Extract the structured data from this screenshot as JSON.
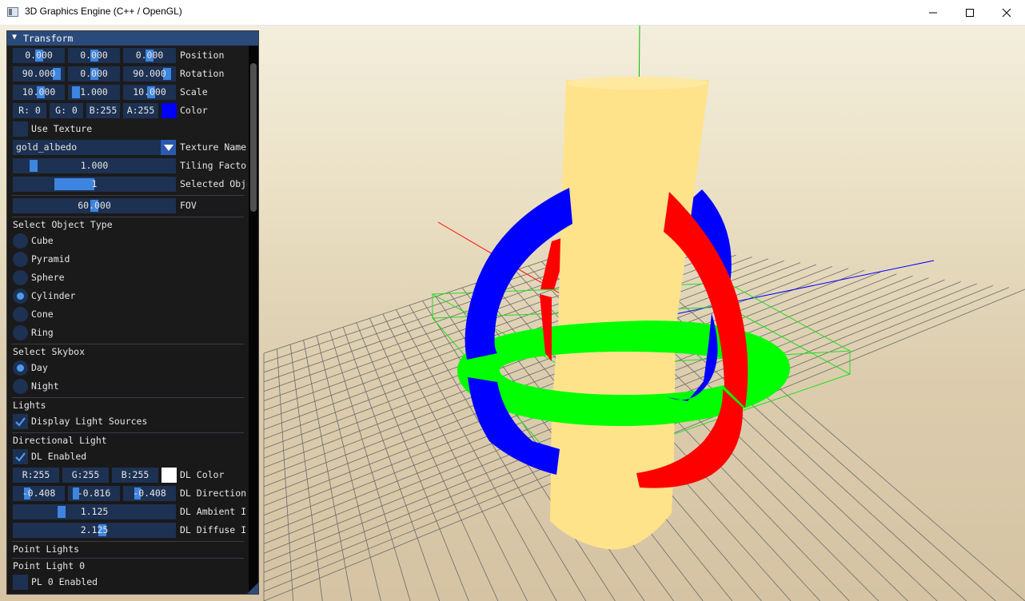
{
  "window": {
    "title": "3D Graphics Engine (C++ / OpenGL)"
  },
  "panel": {
    "header": "Transform",
    "position": {
      "x": "0.000",
      "y": "0.000",
      "z": "0.000",
      "label": "Position"
    },
    "rotation": {
      "x": "90.000",
      "y": "0.000",
      "z": "90.000",
      "label": "Rotation"
    },
    "scale": {
      "x": "10.000",
      "y": "1.000",
      "z": "10.000",
      "label": "Scale"
    },
    "color": {
      "r": "R:  0",
      "g": "G:  0",
      "b": "B:255",
      "a": "A:255",
      "label": "Color",
      "swatch": "#0000ff"
    },
    "use_texture": {
      "label": "Use Texture",
      "checked": false
    },
    "texture_name": {
      "value": "gold_albedo",
      "label": "Texture Name"
    },
    "tiling_factor": {
      "value": "1.000",
      "label": "Tiling Factor"
    },
    "selected_object": {
      "value": "1",
      "label": "Selected Object"
    },
    "fov": {
      "value": "60.000",
      "label": "FOV"
    },
    "object_type": {
      "heading": "Select Object Type",
      "options": [
        "Cube",
        "Pyramid",
        "Sphere",
        "Cylinder",
        "Cone",
        "Ring"
      ],
      "selected": "Cylinder"
    },
    "skybox": {
      "heading": "Select Skybox",
      "options": [
        "Day",
        "Night"
      ],
      "selected": "Day"
    },
    "lights": {
      "heading": "Lights",
      "display_sources": {
        "label": "Display Light Sources",
        "checked": true
      }
    },
    "directional_light": {
      "heading": "Directional Light",
      "enabled": {
        "label": "DL Enabled",
        "checked": true
      },
      "color": {
        "r": "R:255",
        "g": "G:255",
        "b": "B:255",
        "label": "DL Color",
        "swatch": "#ffffff"
      },
      "direction": {
        "x": "-0.408",
        "y": "-0.816",
        "z": "-0.408",
        "label": "DL Direction"
      },
      "ambient": {
        "value": "1.125",
        "label": "DL Ambient Intensity"
      },
      "diffuse": {
        "value": "2.125",
        "label": "DL Diffuse Intensity"
      }
    },
    "point_lights": {
      "heading": "Point Lights",
      "light0": {
        "heading": "Point Light 0",
        "enabled": {
          "label": "PL 0 Enabled",
          "checked": false
        }
      }
    }
  },
  "colors": {
    "panel_bg": "#0e0e10",
    "header_bg": "#2a4a7a",
    "field_bg": "#1d3152",
    "accent": "#3d85e0",
    "object_yellow": "#ffe38a",
    "gizmo_red": "#ff0000",
    "gizmo_green": "#00ff00",
    "gizmo_blue": "#0000ff"
  },
  "icons": [
    "app-icon",
    "minimize-icon",
    "maximize-icon",
    "close-icon",
    "collapse-arrow-icon",
    "dropdown-arrow-icon",
    "checkmark-icon"
  ]
}
